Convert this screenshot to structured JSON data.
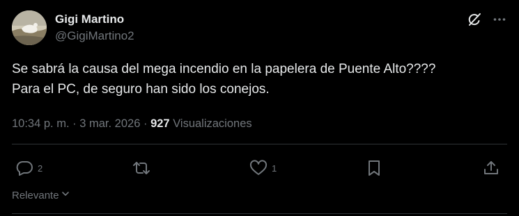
{
  "author": {
    "display_name": "Gigi Martino",
    "handle": "@GigiMartino2"
  },
  "tweet": {
    "line1": "Se sabrá la causa del mega incendio en la papelera de Puente Alto????",
    "line2": "Para el PC, de seguro han sido los conejos."
  },
  "meta": {
    "time": "10:34 p. m.",
    "sep1": "·",
    "date": "3 mar. 2026",
    "sep2": "·",
    "views_count": "927",
    "views_label": "Visualizaciones"
  },
  "actions": {
    "replies": "2",
    "reposts": "",
    "likes": "1"
  },
  "sort": {
    "label": "Relevante"
  },
  "icons": {
    "grok": "grok-icon",
    "more": "more-icon",
    "reply": "reply-icon",
    "repost": "repost-icon",
    "like": "like-icon",
    "bookmark": "bookmark-icon",
    "share": "share-icon",
    "chevron": "chevron-down-icon"
  },
  "colors": {
    "background": "#000000",
    "text": "#e7e9ea",
    "muted": "#71767b",
    "divider": "#2f3336"
  }
}
